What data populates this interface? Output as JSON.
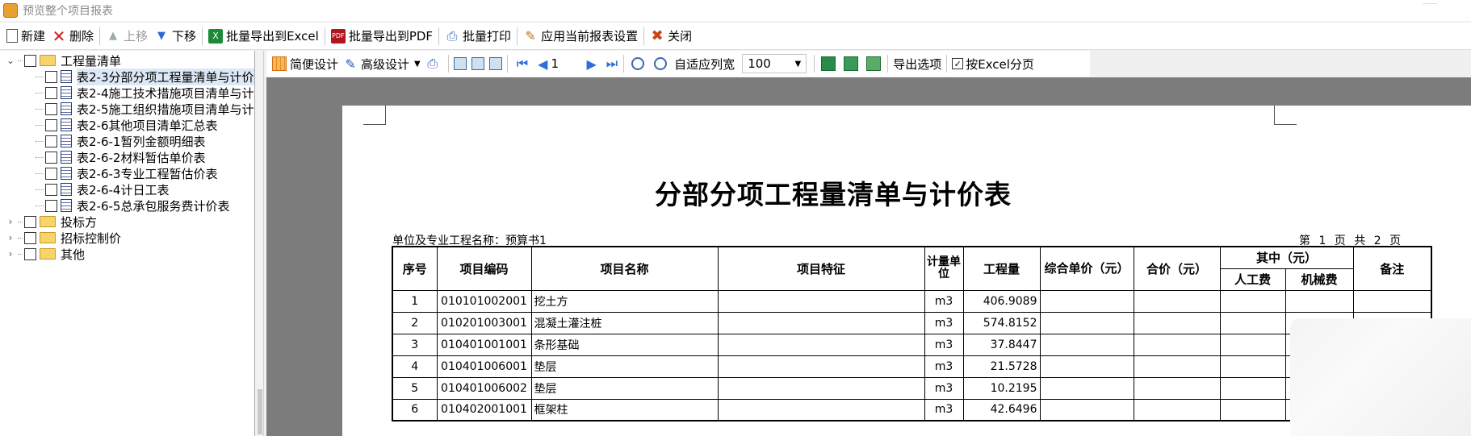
{
  "window": {
    "title": "预览整个项目报表"
  },
  "toolbar": {
    "new": "新建",
    "delete": "删除",
    "move_up": "上移",
    "move_down": "下移",
    "export_excel": "批量导出到Excel",
    "export_pdf": "批量导出到PDF",
    "batch_print": "批量打印",
    "apply_settings": "应用当前报表设置",
    "close": "关闭"
  },
  "tree": {
    "root": "工程量清单",
    "children": [
      "表2-3分部分项工程量清单与计价",
      "表2-4施工技术措施项目清单与计",
      "表2-5施工组织措施项目清单与计",
      "表2-6其他项目清单汇总表",
      "表2-6-1暂列金额明细表",
      "表2-6-2材料暂估单价表",
      "表2-6-3专业工程暂估价表",
      "表2-6-4计日工表",
      "表2-6-5总承包服务费计价表"
    ],
    "others": [
      "投标方",
      "招标控制价",
      "其他"
    ]
  },
  "preview_toolbar": {
    "simple_design": "简便设计",
    "advanced_design": "高级设计",
    "page": "1",
    "fit_width": "自适应列宽",
    "zoom": "100",
    "export_options": "导出选项",
    "excel_paging": "按Excel分页"
  },
  "report": {
    "title": "分部分项工程量清单与计价表",
    "unit_label": "单位及专业工程名称：预算书1",
    "page_info": "第 1 页 共 2 页",
    "headers": {
      "seq": "序号",
      "code": "项目编码",
      "name": "项目名称",
      "feature": "项目特征",
      "unit": "计量单位",
      "qty": "工程量",
      "unit_price": "综合单价（元）",
      "total": "合价（元）",
      "of_which": "其中（元）",
      "labor": "人工费",
      "machine": "机械费",
      "remark": "备注"
    },
    "rows": [
      {
        "seq": "1",
        "code": "010101002001",
        "name": "挖土方",
        "unit": "m3",
        "qty": "406.9089"
      },
      {
        "seq": "2",
        "code": "010201003001",
        "name": "混凝土灌注桩",
        "unit": "m3",
        "qty": "574.8152"
      },
      {
        "seq": "3",
        "code": "010401001001",
        "name": "条形基础",
        "unit": "m3",
        "qty": "37.8447"
      },
      {
        "seq": "4",
        "code": "010401006001",
        "name": "垫层",
        "unit": "m3",
        "qty": "21.5728"
      },
      {
        "seq": "5",
        "code": "010401006002",
        "name": "垫层",
        "unit": "m3",
        "qty": "10.2195"
      },
      {
        "seq": "6",
        "code": "010402001001",
        "name": "框架柱",
        "unit": "m3",
        "qty": "42.6496"
      }
    ]
  }
}
